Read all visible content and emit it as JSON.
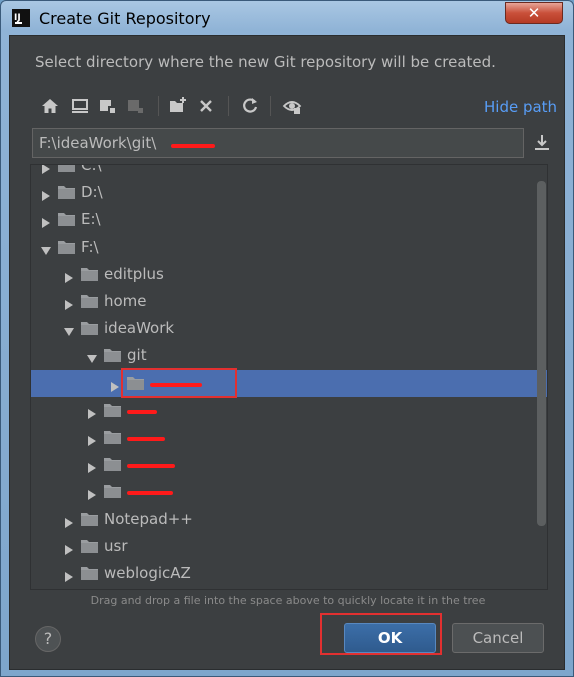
{
  "window": {
    "title": "Create Git Repository",
    "close_label": "✕",
    "app_icon_text": "IJ"
  },
  "dialog": {
    "description": "Select directory where the new Git repository will be created.",
    "hide_path_label": "Hide path",
    "path_value": "F:\\ideaWork\\git\\",
    "hint": "Drag and drop a file into the space above to quickly locate it in the tree",
    "help_label": "?",
    "ok_label": "OK",
    "cancel_label": "Cancel"
  },
  "toolbar": {
    "icons": [
      "home-icon",
      "desktop-icon",
      "new-folder-icon",
      "collapse-icon",
      "add-folder-icon",
      "delete-icon",
      "refresh-icon",
      "show-hidden-icon"
    ]
  },
  "tree": {
    "items": [
      {
        "label": "C:\\",
        "depth": 0,
        "expanded": false
      },
      {
        "label": "D:\\",
        "depth": 0,
        "expanded": false
      },
      {
        "label": "E:\\",
        "depth": 0,
        "expanded": false
      },
      {
        "label": "F:\\",
        "depth": 0,
        "expanded": true
      },
      {
        "label": "editplus",
        "depth": 1,
        "expanded": false
      },
      {
        "label": "home",
        "depth": 1,
        "expanded": false
      },
      {
        "label": "ideaWork",
        "depth": 1,
        "expanded": true
      },
      {
        "label": "git",
        "depth": 2,
        "expanded": true
      },
      {
        "label": "",
        "depth": 3,
        "expanded": false,
        "selected": true
      },
      {
        "label": "",
        "depth": 2,
        "expanded": false
      },
      {
        "label": "",
        "depth": 2,
        "expanded": false
      },
      {
        "label": "",
        "depth": 2,
        "expanded": false
      },
      {
        "label": "",
        "depth": 2,
        "expanded": false
      },
      {
        "label": "Notepad++",
        "depth": 1,
        "expanded": false
      },
      {
        "label": "usr",
        "depth": 1,
        "expanded": false
      },
      {
        "label": "weblogicAZ",
        "depth": 1,
        "expanded": false
      }
    ]
  },
  "colors": {
    "dialog_bg": "#3c3f41",
    "selection": "#4b6eaf",
    "link": "#589df6",
    "text": "#bbbbbb",
    "annotation": "#e23030"
  }
}
